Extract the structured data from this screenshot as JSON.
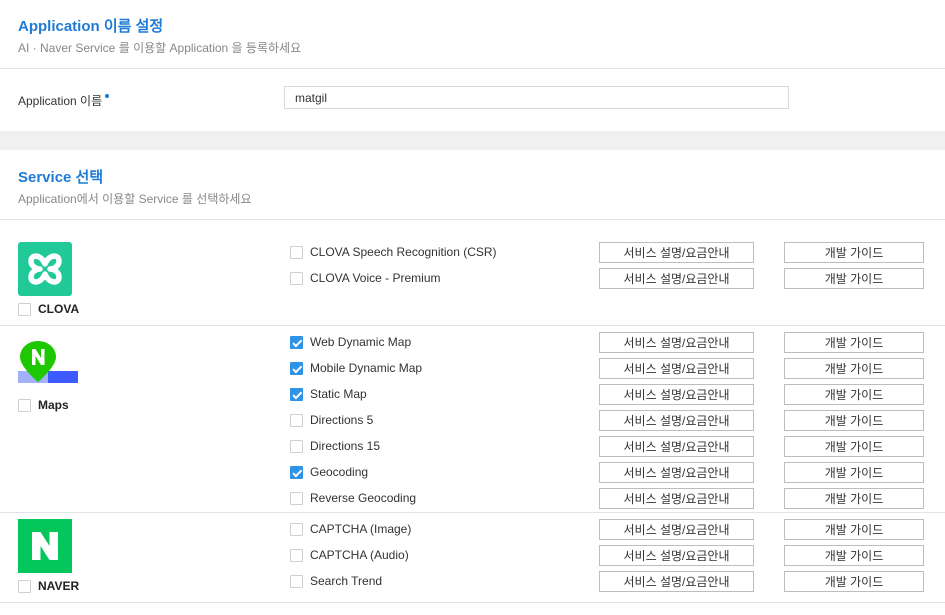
{
  "app_section": {
    "title": "Application 이름 설정",
    "subtitle": "AI · Naver Service 를 이용할 Application 을 등록하세요",
    "field_label": "Application 이름",
    "field_value": "matgil"
  },
  "service_section": {
    "title": "Service 선택",
    "subtitle": "Application에서 이용할 Service 를 선택하세요"
  },
  "buttons": {
    "desc_label": "서비스 설명/요금안내",
    "guide_label": "개발 가이드"
  },
  "groups": [
    {
      "name": "CLOVA",
      "checked": false,
      "color": "#20c997",
      "services": [
        {
          "label": "CLOVA Speech Recognition (CSR)",
          "checked": false
        },
        {
          "label": "CLOVA Voice - Premium",
          "checked": false
        }
      ]
    },
    {
      "name": "Maps",
      "checked": false,
      "color": "#1ec800",
      "services": [
        {
          "label": "Web Dynamic Map",
          "checked": true
        },
        {
          "label": "Mobile Dynamic Map",
          "checked": true
        },
        {
          "label": "Static Map",
          "checked": true
        },
        {
          "label": "Directions 5",
          "checked": false
        },
        {
          "label": "Directions 15",
          "checked": false
        },
        {
          "label": "Geocoding",
          "checked": true
        },
        {
          "label": "Reverse Geocoding",
          "checked": false
        }
      ]
    },
    {
      "name": "NAVER",
      "checked": false,
      "color": "#03c75a",
      "services": [
        {
          "label": "CAPTCHA (Image)",
          "checked": false
        },
        {
          "label": "CAPTCHA (Audio)",
          "checked": false
        },
        {
          "label": "Search Trend",
          "checked": false
        }
      ]
    }
  ],
  "colors": {
    "accent": "#1f7bd6",
    "checkbox_checked": "#2f93e6"
  }
}
